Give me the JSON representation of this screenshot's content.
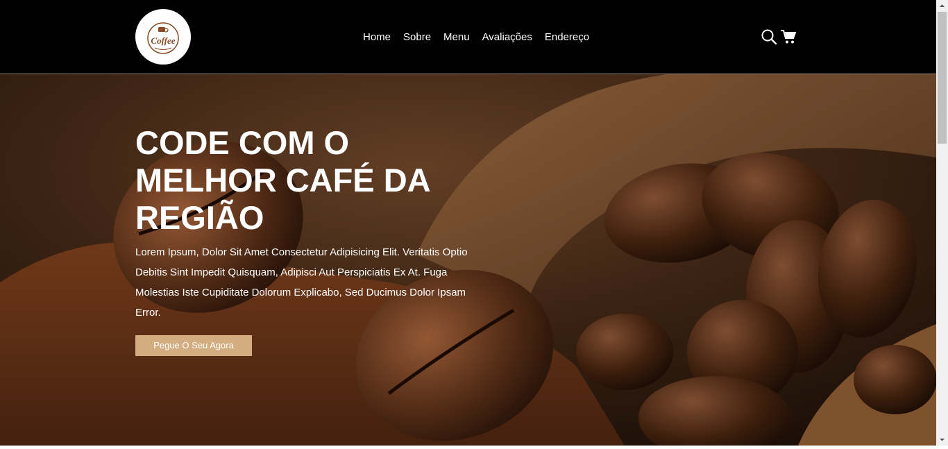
{
  "logo": {
    "text": "Coffee",
    "icon": "coffee-cup-icon"
  },
  "nav": {
    "items": [
      "Home",
      "Sobre",
      "Menu",
      "Avaliações",
      "Endereço"
    ]
  },
  "header_icons": [
    "search-icon",
    "cart-icon"
  ],
  "hero": {
    "title": "CODE COM O MELHOR CAFÉ DA REGIÃO",
    "text": "Lorem Ipsum, Dolor Sit Amet Consectetur Adipisicing Elit. Veritatis Optio Debitis Sint Impedit Quisquam, Adipisci Aut Perspiciatis Ex At. Fuga Molestias Iste Cupiditate Dolorum Explicabo, Sed Ducimus Dolor Ipsam Error.",
    "button": "Pegue O Seu Agora"
  },
  "colors": {
    "header_bg": "#000000",
    "accent": "#d3ad7f",
    "text": "#ffffff"
  }
}
